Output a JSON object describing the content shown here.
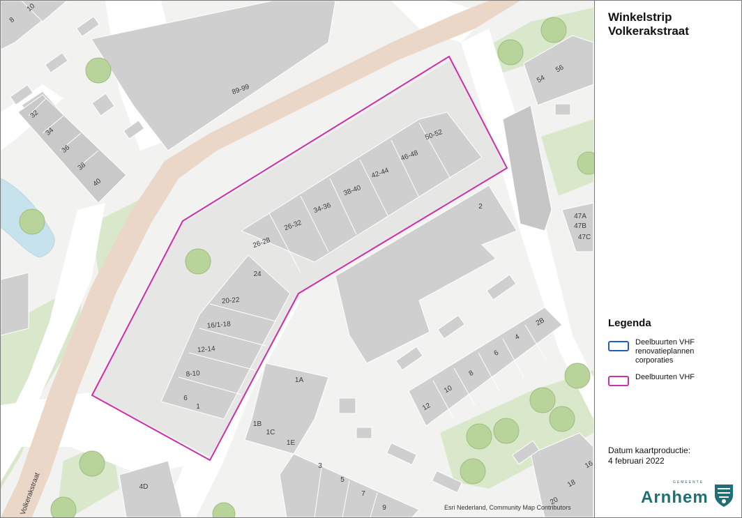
{
  "title_line1": "Winkelstrip",
  "title_line2": "Volkerakstraat",
  "legend": {
    "title": "Legenda",
    "items": [
      {
        "label": "Deelbuurten VHF renovatieplannen corporaties",
        "color": "#1f5fbf"
      },
      {
        "label": "Deelbuurten VHF",
        "color": "#cc2fa8"
      }
    ]
  },
  "date_label": "Datum kaartproductie:",
  "date_value": "4 februari 2022",
  "credit": "Esri Nederland, Community Map Contributors",
  "logo": {
    "small_text": "GEMEENTE",
    "word": "Arnhem",
    "icon": "arnhem-crest-icon"
  },
  "street_labels": [
    "Volkerakstraat"
  ],
  "building_numbers": [
    "8",
    "10",
    "32",
    "34",
    "36",
    "38",
    "40",
    "89-99",
    "26-28",
    "26-32",
    "34-36",
    "38-40",
    "42-44",
    "46-48",
    "50-52",
    "24",
    "20-22",
    "16/1-18",
    "12-14",
    "8-10",
    "6",
    "1",
    "2",
    "1A",
    "1B",
    "1C",
    "1E",
    "3",
    "5",
    "7",
    "9",
    "12",
    "10",
    "8",
    "6",
    "4",
    "2B",
    "54",
    "56",
    "47A",
    "47B",
    "47C",
    "4D",
    "16",
    "18",
    "20"
  ],
  "colors": {
    "building": "#cfcfcf",
    "street": "#ffffff",
    "green": "#d8e8c9",
    "water": "#c7e4ee",
    "bikepath": "#ead6c6",
    "highlight": "#cc2fa8"
  }
}
